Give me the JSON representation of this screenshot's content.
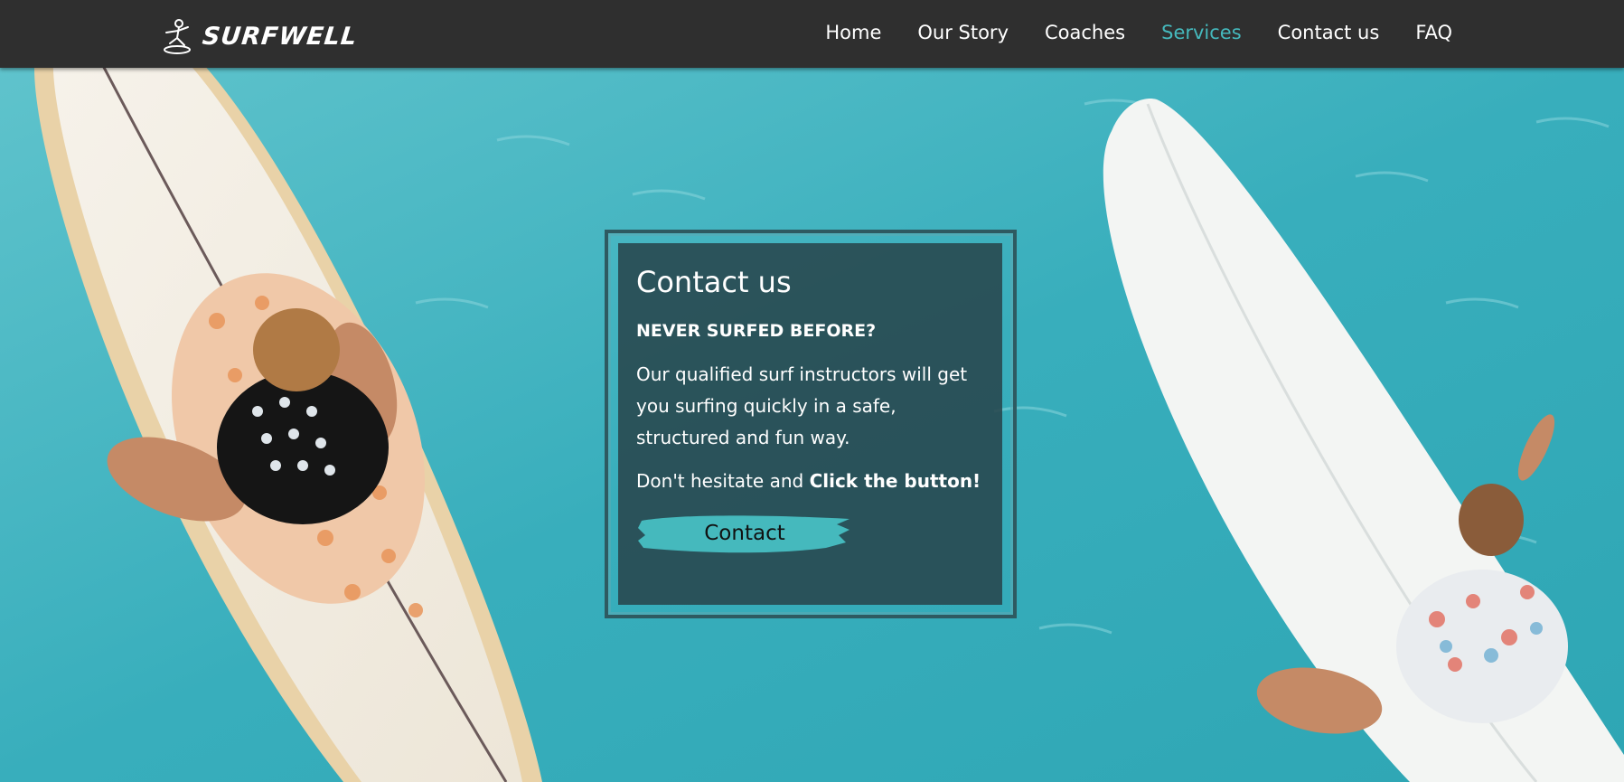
{
  "brand": {
    "name": "SURFWELL"
  },
  "nav": {
    "items": [
      {
        "label": "Home",
        "active": false
      },
      {
        "label": "Our Story",
        "active": false
      },
      {
        "label": "Coaches",
        "active": false
      },
      {
        "label": "Services",
        "active": true
      },
      {
        "label": "Contact us",
        "active": false
      },
      {
        "label": "FAQ",
        "active": false
      }
    ]
  },
  "colors": {
    "navbar": "#2f2f2f",
    "accent": "#45b9bd",
    "card": "#28464c",
    "water": "#3fb3bf"
  },
  "contact_card": {
    "title": "Contact us",
    "subtitle": "NEVER SURFED BEFORE?",
    "body": "Our qualified surf instructors will get you surfing quickly in a safe, structured and fun way.",
    "cta_prefix": "Don't hesitate and ",
    "cta_bold": "Click the button!",
    "button_label": "Contact"
  }
}
